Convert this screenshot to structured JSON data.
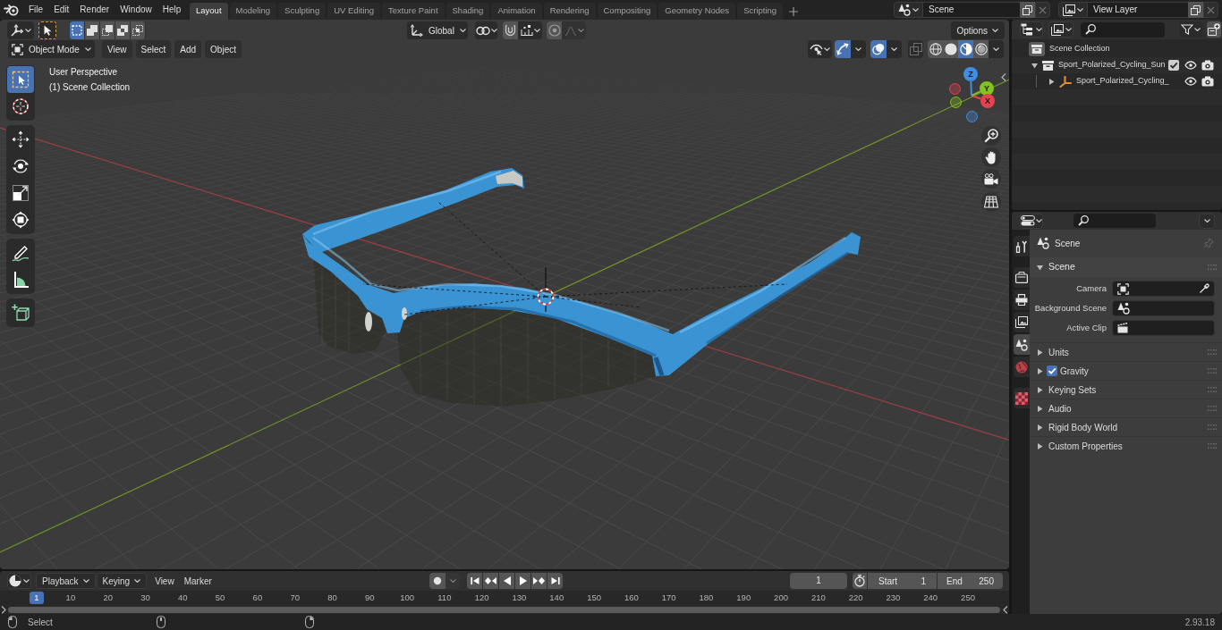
{
  "top_bar": {
    "menus": [
      "File",
      "Edit",
      "Render",
      "Window",
      "Help"
    ],
    "workspaces": [
      {
        "label": "Layout",
        "selected": true
      },
      {
        "label": "Modeling",
        "selected": false
      },
      {
        "label": "Sculpting",
        "selected": false
      },
      {
        "label": "UV Editing",
        "selected": false
      },
      {
        "label": "Texture Paint",
        "selected": false
      },
      {
        "label": "Shading",
        "selected": false
      },
      {
        "label": "Animation",
        "selected": false
      },
      {
        "label": "Rendering",
        "selected": false
      },
      {
        "label": "Compositing",
        "selected": false
      },
      {
        "label": "Geometry Nodes",
        "selected": false
      },
      {
        "label": "Scripting",
        "selected": false
      }
    ],
    "scene": "Scene",
    "view_layer": "View Layer"
  },
  "viewport": {
    "header": {
      "select_modes": [
        {
          "kind": "set",
          "selected": true
        },
        {
          "kind": "extend",
          "selected": false
        },
        {
          "kind": "subtract",
          "selected": false
        },
        {
          "kind": "difference",
          "selected": false
        },
        {
          "kind": "intersect",
          "selected": false
        }
      ],
      "orientation": "Global",
      "snap": {
        "on": false
      },
      "proportional": {
        "on": false
      },
      "options": "Options",
      "mode": "Object Mode",
      "menus": [
        "View",
        "Select",
        "Add",
        "Object"
      ],
      "gizmos": {
        "on": true
      },
      "overlays": {
        "on": true
      },
      "xray": {
        "on": false
      },
      "shading": [
        {
          "kind": "wireframe",
          "selected": false
        },
        {
          "kind": "solid",
          "selected": false
        },
        {
          "kind": "material",
          "selected": true
        },
        {
          "kind": "rendered",
          "selected": false
        }
      ]
    },
    "tool_groups": [
      [
        {
          "kind": "select_box",
          "selected": true
        },
        {
          "kind": "cursor",
          "selected": false
        }
      ],
      [
        {
          "kind": "move",
          "selected": false
        },
        {
          "kind": "rotate",
          "selected": false
        },
        {
          "kind": "scale",
          "selected": false
        },
        {
          "kind": "transform",
          "selected": false
        }
      ],
      [
        {
          "kind": "annotate",
          "selected": false
        },
        {
          "kind": "measure",
          "selected": false
        }
      ],
      [
        {
          "kind": "add_cube",
          "selected": false
        }
      ]
    ],
    "overlay_text": [
      "User Perspective",
      "(1) Scene Collection"
    ],
    "axes": [
      {
        "label": "X",
        "color": "#e5424f"
      },
      {
        "label": "Y",
        "color": "#83c21f"
      },
      {
        "label": "Z",
        "color": "#3e8ee4"
      }
    ]
  },
  "outliner": {
    "tree": [
      {
        "label": "Scene Collection",
        "kind": "scene_collection",
        "children": [
          {
            "label": "Sport_Polarized_Cycling_Sun",
            "kind": "collection",
            "expanded": true,
            "checked": true,
            "visible": true,
            "renderable": true,
            "children": [
              {
                "label": "Sport_Polarized_Cycling_",
                "kind": "empty",
                "expanded": false,
                "visible": true,
                "renderable": true
              }
            ]
          }
        ]
      }
    ]
  },
  "properties": {
    "tab_groups": [
      [
        {
          "kind": "tool",
          "selected": false
        }
      ],
      [
        {
          "kind": "render",
          "selected": false
        },
        {
          "kind": "output",
          "selected": false
        },
        {
          "kind": "view_layer",
          "selected": false
        },
        {
          "kind": "scene",
          "selected": true
        },
        {
          "kind": "world",
          "selected": false
        }
      ],
      [
        {
          "kind": "texture",
          "selected": false
        }
      ]
    ],
    "context": "Scene",
    "panel": {
      "title": "Scene",
      "expanded": true,
      "fields": [
        {
          "label": "Camera",
          "kind": "camera"
        },
        {
          "label": "Background Scene",
          "kind": "scene"
        },
        {
          "label": "Active Clip",
          "kind": "clip"
        }
      ]
    },
    "subpanels": [
      {
        "label": "Units",
        "expanded": false
      },
      {
        "label": "Gravity",
        "expanded": false,
        "checked": true
      },
      {
        "label": "Keying Sets",
        "expanded": false
      },
      {
        "label": "Audio",
        "expanded": false
      },
      {
        "label": "Rigid Body World",
        "expanded": false
      },
      {
        "label": "Custom Properties",
        "expanded": false
      }
    ]
  },
  "timeline": {
    "menus": [
      {
        "label": "Playback",
        "kind": "dropdown"
      },
      {
        "label": "Keying",
        "kind": "dropdown"
      },
      {
        "label": "View",
        "kind": "menu"
      },
      {
        "label": "Marker",
        "kind": "menu"
      }
    ],
    "auto_keying": false,
    "current_frame": "1",
    "start": {
      "label": "Start",
      "value": "1"
    },
    "end": {
      "label": "End",
      "value": "250"
    },
    "playhead": "1",
    "ruler": [
      "10",
      "20",
      "30",
      "40",
      "50",
      "60",
      "70",
      "80",
      "90",
      "100",
      "110",
      "120",
      "130",
      "140",
      "150",
      "160",
      "170",
      "180",
      "190",
      "200",
      "210",
      "220",
      "230",
      "240",
      "250"
    ]
  },
  "status_bar": {
    "hints": [
      {
        "kind": "left_mouse",
        "label": "Select"
      },
      {
        "kind": "middle_mouse"
      },
      {
        "kind": "right_mouse"
      }
    ],
    "version": "2.93.18"
  }
}
